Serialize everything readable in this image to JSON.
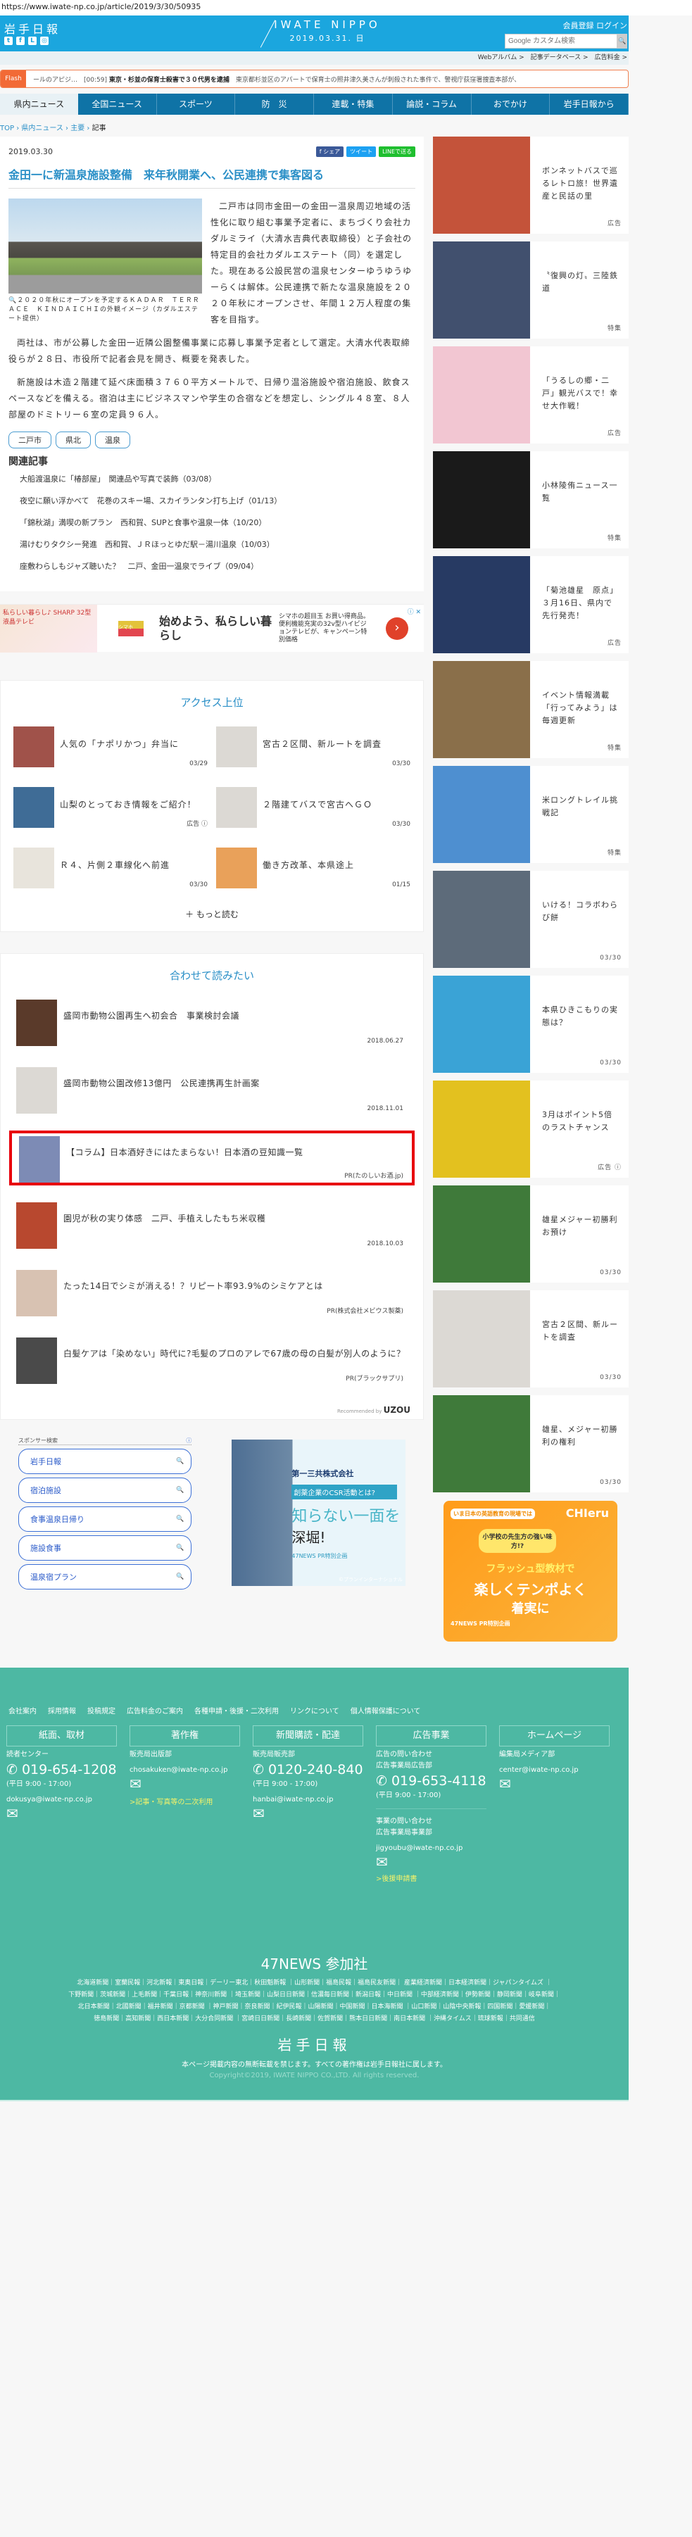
{
  "url": "https://www.iwate-np.co.jp/article/2019/3/30/50935",
  "header": {
    "logo_jp": "岩手日報",
    "social": [
      "t",
      "f",
      "L",
      "◎"
    ],
    "brand": "IWATE NIPPO",
    "date": "2019.03.31. 日",
    "register": "会員登録",
    "login": "ログイン",
    "search_placeholder": "Google カスタム検索",
    "search_icon": "🔍",
    "color": "#1ba6de"
  },
  "sub_links": "Webアルバム >　記事データベース >　広告料金 >",
  "flash": {
    "label": "Flash",
    "text_pre": "ールのアピジ…　[00:59]",
    "headline": "東京・杉並の保育士殺害で３０代男を逮捕",
    "text_post": "　東京都杉並区のアパートで保育士の照井津久美さんが刺殺された事件で、警視庁荻窪署捜査本部が、"
  },
  "nav": [
    "県内ニュース",
    "全国ニュース",
    "スポーツ",
    "防　災",
    "連載・特集",
    "論説・コラム",
    "おでかけ",
    "岩手日報から"
  ],
  "breadcrumb": {
    "top": "TOP",
    "c1": "県内ニュース",
    "c2": "主要",
    "current": "記事",
    "sep": " › "
  },
  "article": {
    "date": "2019.03.30",
    "share": [
      "f シェア",
      "ツイート",
      "LINEで送る"
    ],
    "title": "金田一に新温泉施設整備　来年秋開業へ、公民連携で集客図る",
    "caption": "🔍２０２０年秋にオープンを予定するＫＡＤＡＲ　ＴＥＲＲＡＣＥ　ＫＩＮＤＡＩＣＨＩの外観イメージ（カダルエステート提供）",
    "paragraphs": [
      "二戸市は同市金田一の金田一温泉周辺地域の活性化に取り組む事業予定者に、まちづくり会社カダルミライ（大清水吉典代表取締役）と子会社の特定目的会社カダルエステート（同）を選定した。現在ある公設民営の温泉センターゆうゆうゆーらくは解体。公民連携で新たな温泉施設を２０２０年秋にオープンさせ、年間１２万人程度の集客を目指す。",
      "両社は、市が公募した金田一近隣公園整備事業に応募し事業予定者として選定。大清水代表取締役らが２８日、市役所で記者会見を開き、概要を発表した。",
      "新施設は木造２階建て延べ床面積３７６０平方メートルで、日帰り温浴施設や宿泊施設、飲食スペースなどを備える。宿泊は主にビジネスマンや学生の合宿などを想定し、シングル４８室、８人部屋のドミトリー６室の定員９６人。"
    ],
    "tags": [
      "二戸市",
      "県北",
      "温泉"
    ],
    "related_heading": "関連記事",
    "related": [
      "大船渡温泉に「椿部屋」　関連品や写真で装飾（03/08）",
      "夜空に願い浮かべて　花巻のスキー場、スカイランタン打ち上げ（01/13）",
      "「錦秋湖」満喫の新プラン　西和賀、SUPと食事や温泉一体（10/20）",
      "湯けむりタクシー発進　西和賀、ＪＲほっとゆだ駅－湯川温泉（10/03）",
      "座敷わらしもジャズ聴いた？　二戸、金田一温泉でライブ（09/04）"
    ]
  },
  "ad": {
    "img_text": "私らしい暮らし♪ SHARP 32型液晶テレビ",
    "logo": "シマホ",
    "headline": "始めよう、私らしい暮らし",
    "desc": "シマホの超目玉 お買い得商品。便利機能充実の32v型ハイビジョンテレビが、キャンペーン特別価格",
    "go": "›",
    "close": "ⓘ ✕"
  },
  "ranking": {
    "heading": "アクセス上位",
    "items": [
      {
        "title": "人気の「ナポリかつ」弁当に",
        "date": "03/29",
        "thumb_color": "#a0524a"
      },
      {
        "title": "宮古２区間、新ルートを調査",
        "date": "03/30",
        "thumb_color": "#dcd9d4"
      },
      {
        "title": "山梨のとっておき情報をご紹介！",
        "date": "広告 ⓘ",
        "thumb_color": "#3f6c96"
      },
      {
        "title": "２階建てバスで宮古へＧＯ",
        "date": "03/30",
        "thumb_color": "#dcd9d4"
      },
      {
        "title": "Ｒ４、片側２車線化へ前進",
        "date": "03/30",
        "thumb_color": "#e8e4dc"
      },
      {
        "title": "働き方改革、本県途上",
        "date": "01/15",
        "thumb_color": "#e9a15a"
      }
    ],
    "more": "＋ もっと読む"
  },
  "recommend": {
    "heading": "合わせて読みたい",
    "items": [
      {
        "title": "盛岡市動物公園再生へ初会合　事業検討会議",
        "date": "2018.06.27",
        "thumb_color": "#5a3a2a"
      },
      {
        "title": "盛岡市動物公園改修13億円　公民連携再生計画案",
        "date": "2018.11.01",
        "thumb_color": "#dcd9d4"
      },
      {
        "title": "【コラム】日本酒好きにはたまらない！日本酒の豆知識一覧",
        "date": "PR(たのしいお酒.jp)",
        "thumb_color": "#7d8bb5"
      },
      {
        "title": "園児が秋の実り体感　二戸、手植えしたもち米収穫",
        "date": "2018.10.03",
        "thumb_color": "#b8482f"
      },
      {
        "title": "たった14日でシミが消える！？リピート率93.9%のシミケアとは",
        "date": "PR(株式会社メビウス製薬)",
        "thumb_color": "#d8c2b2"
      },
      {
        "title": "白髪ケアは「染めない」時代に?毛髪のプロのアレで67歳の母の白髪が別人のように？",
        "date": "PR(ブラックサプリ)",
        "thumb_color": "#4a4a4a"
      }
    ],
    "recommended_by": "Recommended by",
    "uzou": "UZOU"
  },
  "sponsor": {
    "heading": "スポンサー検索",
    "info": "ⓘ",
    "items": [
      "岩手日報",
      "宿泊施設",
      "食事温泉日帰り",
      "施設食事",
      "温泉宿プラン"
    ],
    "search_icon": "🔍"
  },
  "sponsor_ad": {
    "company": "第一三共株式会社",
    "banner": "創薬企業のCSR活動とは?",
    "line1": "知らない一面を",
    "line2": "深堀!",
    "pr": "47NEWS PR特別企画",
    "credit": "©プランインターナショナル"
  },
  "sidebar": [
    {
      "title": "ボンネットバスで巡るレトロ旅！世界遺産と民話の里",
      "label": "広告",
      "thumb_color": "#c4533a"
    },
    {
      "title": "〝復興の灯〟三陸鉄道",
      "label": "特集",
      "thumb_color": "#41506e"
    },
    {
      "title": "「うるしの郷・二戸」観光バスで！幸せ大作戦！",
      "label": "広告",
      "thumb_color": "#f2c6d2"
    },
    {
      "title": "小林陵侑ニュース一覧",
      "label": "特集",
      "thumb_color": "#1a1a1a"
    },
    {
      "title": "「菊池雄星　原点」３月16日、県内で先行発売！",
      "label": "広告",
      "thumb_color": "#273a63"
    },
    {
      "title": "イベント情報満載「行ってみよう」は毎週更新",
      "label": "特集",
      "thumb_color": "#8a6f4a"
    },
    {
      "title": "米ロングトレイル挑戦記",
      "label": "特集",
      "thumb_color": "#4e8fd0"
    },
    {
      "title": "いける！コラボわらび餅",
      "label": "03/30",
      "thumb_color": "#5d6b7a"
    },
    {
      "title": "本県ひきこもりの実態は？",
      "label": "03/30",
      "thumb_color": "#3aa3d6"
    },
    {
      "title": "3月はポイント5倍のラストチャンス",
      "label": "広告 ⓘ",
      "thumb_color": "#e3c11f"
    },
    {
      "title": "雄星メジャー初勝利お預け",
      "label": "03/30",
      "thumb_color": "#3f7a3a"
    },
    {
      "title": "宮古２区間、新ルートを調査",
      "label": "03/30",
      "thumb_color": "#dcd9d4"
    },
    {
      "title": "雄星、メジャー初勝利の権利",
      "label": "03/30",
      "thumb_color": "#3f7a3a"
    }
  ],
  "chieru_ad": {
    "tag": "いま日本の英語教育の現場では",
    "brand": "CHIeru",
    "bubble": "小学校の先生方の強い味方!?",
    "line1": "フラッシュ型教材で",
    "line2": "楽しくテンポよく",
    "line3": "着実に",
    "pr": "47NEWS PR特別企画"
  },
  "footer": {
    "links": [
      "会社案内",
      "採用情報",
      "投稿規定",
      "広告料金のご案内",
      "各種申請・後援・二次利用",
      "リンクについて",
      "個人情報保護について"
    ],
    "cols": [
      {
        "head": "紙面、取材",
        "dept": "読者センター",
        "tel": "✆ 019-654-1208",
        "hours": "(平日 9:00 - 17:00)",
        "email": "dokusya@iwate-np.co.jp"
      },
      {
        "head": "著作権",
        "dept": "販売局出版部",
        "email": "chosakuken@iwate-np.co.jp",
        "link": ">記事・写真等の二次利用"
      },
      {
        "head": "新聞購読・配達",
        "dept": "販売局販売部",
        "tel": "✆ 0120-240-840",
        "hours": "(平日 9:00 - 17:00)",
        "email": "hanbai@iwate-np.co.jp"
      },
      {
        "head": "広告事業",
        "dept": "広告の問い合わせ",
        "dept2": "広告事業局広告部",
        "tel": "✆ 019-653-4118",
        "hours": "(平日 9:00 - 17:00)",
        "dept3": "事業の問い合わせ",
        "dept4": "広告事業局事業部",
        "email": "jigyoubu@iwate-np.co.jp",
        "link": ">後援申請書"
      },
      {
        "head": "ホームページ",
        "dept": "編集局メディア部",
        "email": "center@iwate-np.co.jp"
      }
    ],
    "mail_icon": "✉",
    "news47": "47NEWS 参加社",
    "papers": [
      "北海道新聞｜室蘭民報｜河北新報｜東奥日報｜デーリー東北｜秋田魁新報 ｜山形新聞｜福島民報｜福島民友新聞｜ 産業経済新聞｜日本経済新聞｜ジャパンタイムズ ｜",
      "下野新聞｜茨城新聞｜上毛新聞｜千葉日報｜神奈川新聞 ｜埼玉新聞｜山梨日日新聞｜信濃毎日新聞｜新潟日報｜中日新聞 ｜中部経済新聞｜伊勢新聞｜静岡新聞｜岐阜新聞｜",
      "北日本新聞｜北國新聞｜福井新聞｜京都新聞 ｜神戸新聞｜奈良新聞｜紀伊民報｜山陽新聞｜中国新聞｜日本海新聞 ｜山口新聞｜山陰中央新報｜四国新聞｜愛媛新聞｜",
      "徳島新聞｜高知新聞｜西日本新聞｜大分合同新聞 ｜宮崎日日新聞｜長崎新聞｜佐賀新聞｜熊本日日新聞｜南日本新聞 ｜沖縄タイムス｜琉球新報｜共同通信"
    ],
    "logo": "岩手日報",
    "notice": "本ページ掲載内容の無断転載を禁じます。すべての著作権は岩手日報社に属します。",
    "copyright": "Copyright©2019, IWATE NIPPO CO.,LTD. All rights reserved.",
    "color": "#4db8a3"
  }
}
